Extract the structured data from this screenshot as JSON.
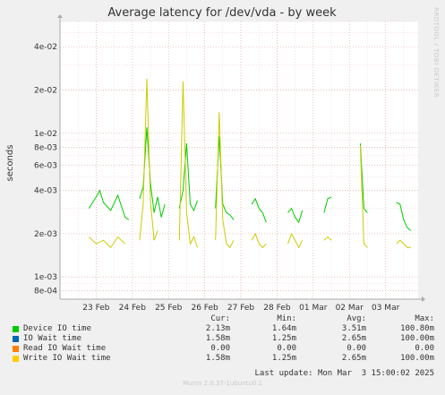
{
  "chart_data": {
    "type": "line",
    "title": "Average latency for /dev/vda - by week",
    "ylabel": "seconds",
    "y_scale": "log",
    "ylim": [
      0.0007,
      0.06
    ],
    "yticks": [
      {
        "v": 0.0008,
        "label": "8e-04"
      },
      {
        "v": 0.001,
        "label": "1e-03"
      },
      {
        "v": 0.002,
        "label": "2e-03"
      },
      {
        "v": 0.004,
        "label": "4e-03"
      },
      {
        "v": 0.006,
        "label": "6e-03"
      },
      {
        "v": 0.008,
        "label": "8e-03"
      },
      {
        "v": 0.01,
        "label": "1e-02"
      },
      {
        "v": 0.02,
        "label": "2e-02"
      },
      {
        "v": 0.04,
        "label": "4e-02"
      }
    ],
    "x_dates": [
      "23 Feb",
      "24 Feb",
      "25 Feb",
      "26 Feb",
      "27 Feb",
      "28 Feb",
      "01 Mar",
      "02 Mar",
      "03 Mar"
    ],
    "grid": true,
    "series": [
      {
        "name": "Device IO time",
        "color": "#00cc00",
        "bursts": [
          {
            "x": [
              22.8,
              23.0,
              23.1,
              23.2,
              23.4,
              23.6,
              23.8,
              23.9
            ],
            "y": [
              0.003,
              0.0036,
              0.004,
              0.0033,
              0.0029,
              0.0037,
              0.0026,
              0.0025
            ]
          },
          {
            "x": [
              24.2,
              24.3,
              24.4,
              24.5,
              24.6,
              24.7,
              24.8,
              24.9
            ],
            "y": [
              0.0035,
              0.0042,
              0.011,
              0.0045,
              0.0028,
              0.0036,
              0.0026,
              0.0032
            ]
          },
          {
            "x": [
              25.3,
              25.4,
              25.5,
              25.6,
              25.7,
              25.8
            ],
            "y": [
              0.003,
              0.004,
              0.0085,
              0.0032,
              0.0029,
              0.0034
            ]
          },
          {
            "x": [
              26.3,
              26.4,
              26.5,
              26.6,
              26.7,
              26.8
            ],
            "y": [
              0.003,
              0.0095,
              0.0032,
              0.0028,
              0.0027,
              0.0025
            ]
          },
          {
            "x": [
              27.3,
              27.4,
              27.5,
              27.6,
              27.7
            ],
            "y": [
              0.0032,
              0.0035,
              0.003,
              0.0028,
              0.0024
            ]
          },
          {
            "x": [
              28.3,
              28.4,
              28.5,
              28.6,
              28.7
            ],
            "y": [
              0.0028,
              0.003,
              0.0026,
              0.0024,
              0.0029
            ]
          },
          {
            "x": [
              29.3,
              29.4,
              29.5
            ],
            "y": [
              0.0028,
              0.0035,
              0.0036
            ]
          },
          {
            "x": [
              30.3,
              30.4,
              30.5
            ],
            "y": [
              0.0085,
              0.003,
              0.0028
            ]
          },
          {
            "x": [
              31.3,
              31.4,
              31.5,
              31.6,
              31.7
            ],
            "y": [
              0.0033,
              0.0032,
              0.0025,
              0.0022,
              0.0021
            ]
          }
        ]
      },
      {
        "name": "Write IO Wait time",
        "color": "#cccc00",
        "bursts": [
          {
            "x": [
              22.8,
              23.0,
              23.2,
              23.4,
              23.6,
              23.8
            ],
            "y": [
              0.0019,
              0.0017,
              0.0018,
              0.0016,
              0.0019,
              0.0017
            ]
          },
          {
            "x": [
              24.2,
              24.3,
              24.4,
              24.5,
              24.6,
              24.7
            ],
            "y": [
              0.0018,
              0.0032,
              0.024,
              0.0034,
              0.0018,
              0.0021
            ]
          },
          {
            "x": [
              25.3,
              25.4,
              25.5,
              25.6,
              25.7,
              25.8
            ],
            "y": [
              0.0018,
              0.023,
              0.0028,
              0.0017,
              0.0019,
              0.0016
            ]
          },
          {
            "x": [
              26.3,
              26.4,
              26.5,
              26.6,
              26.7,
              26.8
            ],
            "y": [
              0.0018,
              0.014,
              0.0025,
              0.0017,
              0.0016,
              0.0018
            ]
          },
          {
            "x": [
              27.3,
              27.4,
              27.5,
              27.6,
              27.7
            ],
            "y": [
              0.0018,
              0.002,
              0.0017,
              0.0016,
              0.0017
            ]
          },
          {
            "x": [
              28.3,
              28.4,
              28.5,
              28.6,
              28.7
            ],
            "y": [
              0.0017,
              0.002,
              0.0018,
              0.0016,
              0.0018
            ]
          },
          {
            "x": [
              29.3,
              29.4,
              29.5
            ],
            "y": [
              0.0018,
              0.0019,
              0.0018
            ]
          },
          {
            "x": [
              30.3,
              30.4,
              30.5
            ],
            "y": [
              0.0082,
              0.0017,
              0.0016
            ]
          },
          {
            "x": [
              31.3,
              31.4,
              31.5,
              31.6,
              31.7
            ],
            "y": [
              0.0017,
              0.0018,
              0.0017,
              0.0016,
              0.0016
            ]
          }
        ]
      }
    ]
  },
  "rrdtool_label": "RRDTOOL / TOBI OETIKER",
  "legend": {
    "headers": {
      "cur": "Cur:",
      "min": "Min:",
      "avg": "Avg:",
      "max": "Max:"
    },
    "rows": [
      {
        "label": "Device IO time",
        "color": "#00cc00",
        "cur": "2.13m",
        "min": "1.64m",
        "avg": "3.51m",
        "max": "100.80m"
      },
      {
        "label": "IO Wait time",
        "color": "#0066b3",
        "cur": "1.58m",
        "min": "1.25m",
        "avg": "2.65m",
        "max": "100.00m"
      },
      {
        "label": "Read IO Wait time",
        "color": "#ff8000",
        "cur": "0.00",
        "min": "0.00",
        "avg": "0.00",
        "max": "0.00"
      },
      {
        "label": "Write IO Wait time",
        "color": "#ffcc00",
        "cur": "1.58m",
        "min": "1.25m",
        "avg": "2.65m",
        "max": "100.00m"
      }
    ],
    "last_update": "Last update: Mon Mar  3 15:00:02 2025"
  },
  "footer": "Munin 2.0.37-1ubuntu0.1"
}
